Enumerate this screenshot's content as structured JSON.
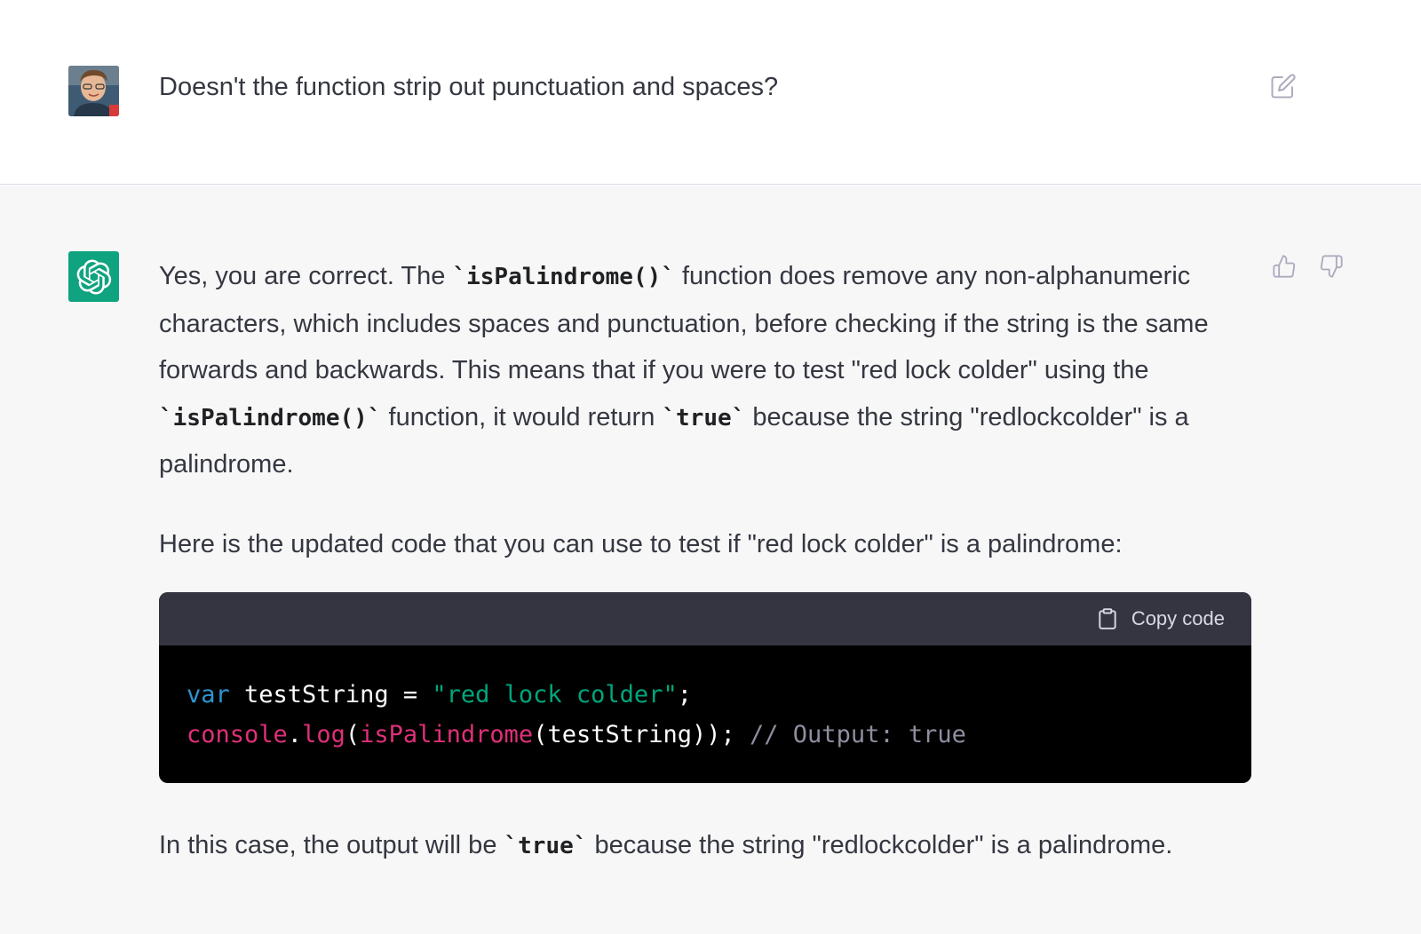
{
  "user_message": {
    "text": "Doesn't the function strip out punctuation and spaces?",
    "edit_icon": "edit-icon"
  },
  "assistant_message": {
    "p1": {
      "t1": "Yes, you are correct. The ",
      "c1": "`isPalindrome()`",
      "t2": " function does remove any non-alphanumeric characters, which includes spaces and punctuation, before checking if the string is the same forwards and backwards. This means that if you were to test \"red lock colder\" using the ",
      "c2": "`isPalindrome()`",
      "t3": " function, it would return ",
      "c3": "`true`",
      "t4": " because the string \"redlockcolder\" is a palindrome."
    },
    "p2": "Here is the updated code that you can use to test if \"red lock colder\" is a palindrome:",
    "code": {
      "copy_label": "Copy code",
      "line1": {
        "kw": "var",
        "ident": " testString = ",
        "str": "\"red lock colder\"",
        "end": ";"
      },
      "line2": {
        "fn1": "console",
        "dot": ".",
        "fn2": "log",
        "paren": "(",
        "fn3": "isPalindrome",
        "args": "(testString)); ",
        "comment": "// Output: true"
      }
    },
    "p3": {
      "t1": "In this case, the output will be ",
      "c1": "`true`",
      "t2": " because the string \"redlockcolder\" is a palindrome."
    }
  },
  "icons": {
    "bot_avatar": "openai-logo-icon",
    "thumbs_up": "thumbs-up-icon",
    "thumbs_down": "thumbs-down-icon",
    "clipboard": "clipboard-icon"
  },
  "colors": {
    "bot_avatar_bg": "#10a37f",
    "assistant_bg": "#f7f7f8",
    "code_header_bg": "#343541",
    "code_body_bg": "#000000",
    "keyword": "#2e95d3",
    "string": "#00a67d",
    "function": "#df3079",
    "comment": "#8e8ea0"
  }
}
